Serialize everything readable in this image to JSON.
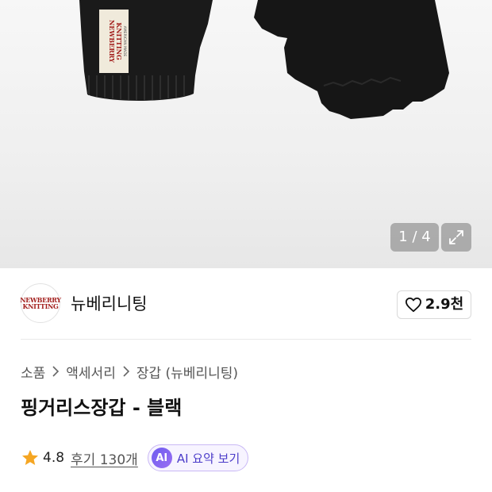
{
  "gallery": {
    "current_page": "1 / 4",
    "label_brand_line1": "NEWBERRY",
    "label_brand_line2": "KNITTING",
    "label_made_in": "AMERICAN MADE"
  },
  "brand": {
    "logo_text_line1": "NEWBERRY",
    "logo_text_line2": "KNITTING",
    "name": "뉴베리니팅",
    "like_count": "2.9천"
  },
  "breadcrumb": [
    "소품",
    "액세서리",
    "장갑 (뉴베리니팅)"
  ],
  "product": {
    "title": "핑거리스장갑 - 블랙"
  },
  "rating": {
    "score": "4.8",
    "reviews_label": "후기 130개",
    "ai_badge": "AI",
    "ai_label": "AI 요약 보기"
  },
  "colors": {
    "star": "#f5a623",
    "ai_accent": "#6d5cf0",
    "brand_logo_red": "#a3201e"
  }
}
